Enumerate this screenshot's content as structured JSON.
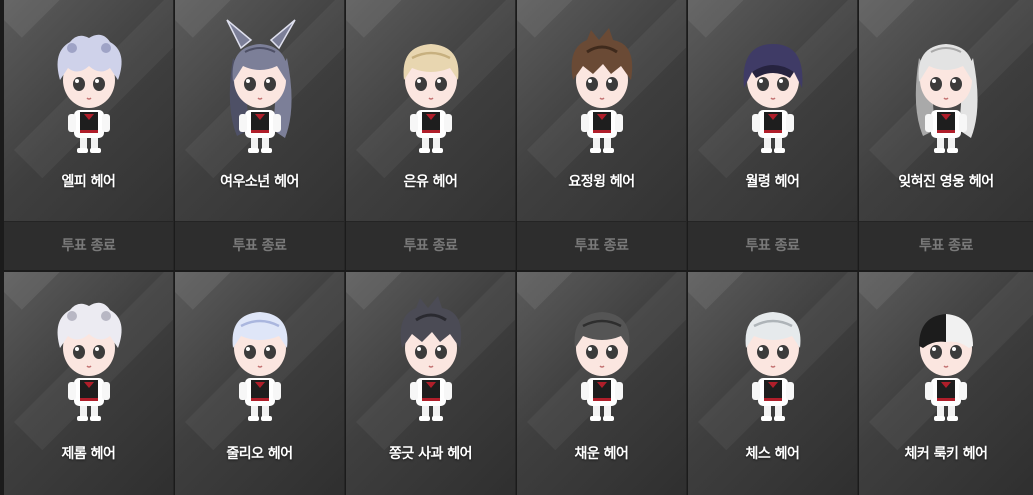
{
  "rows": [
    [
      {
        "name": "엘피 헤어",
        "status": "투표 종료",
        "hair": "#cfd2ea",
        "hair_shade": "#9fa3c6",
        "style": "curly"
      },
      {
        "name": "여우소년 헤어",
        "status": "투표 종료",
        "hair": "#7c7f98",
        "hair_shade": "#4e5066",
        "style": "fox"
      },
      {
        "name": "은유 헤어",
        "status": "투표 종료",
        "hair": "#e8d6b0",
        "hair_shade": "#c7b07f",
        "style": "short"
      },
      {
        "name": "요정윙 헤어",
        "status": "투표 종료",
        "hair": "#6a4a35",
        "hair_shade": "#3f2a1c",
        "style": "messy"
      },
      {
        "name": "월령 헤어",
        "status": "투표 종료",
        "hair": "#3f3b66",
        "hair_shade": "#26233f",
        "style": "bob"
      },
      {
        "name": "잊혀진 영웅 헤어",
        "status": "투표 종료",
        "hair": "#e3e3e3",
        "hair_shade": "#a9a9a9",
        "style": "long"
      }
    ],
    [
      {
        "name": "제롬 헤어",
        "hair": "#ecebf2",
        "hair_shade": "#b8b7c4",
        "style": "curly"
      },
      {
        "name": "줄리오 헤어",
        "hair": "#dfe6f8",
        "hair_shade": "#aab6de",
        "style": "short"
      },
      {
        "name": "쫑긋 사과 헤어",
        "hair": "#4b4b55",
        "hair_shade": "#2a2a30",
        "style": "messy"
      },
      {
        "name": "채운 헤어",
        "hair": "#555555",
        "hair_shade": "#2e2e2e",
        "style": "short"
      },
      {
        "name": "체스 헤어",
        "hair": "#e6eaec",
        "hair_shade": "#aeb4b8",
        "style": "short"
      },
      {
        "name": "체커 룩키 헤어",
        "hair": "#f1f1f1",
        "hair_shade": "#1c1c1c",
        "style": "split"
      }
    ]
  ]
}
